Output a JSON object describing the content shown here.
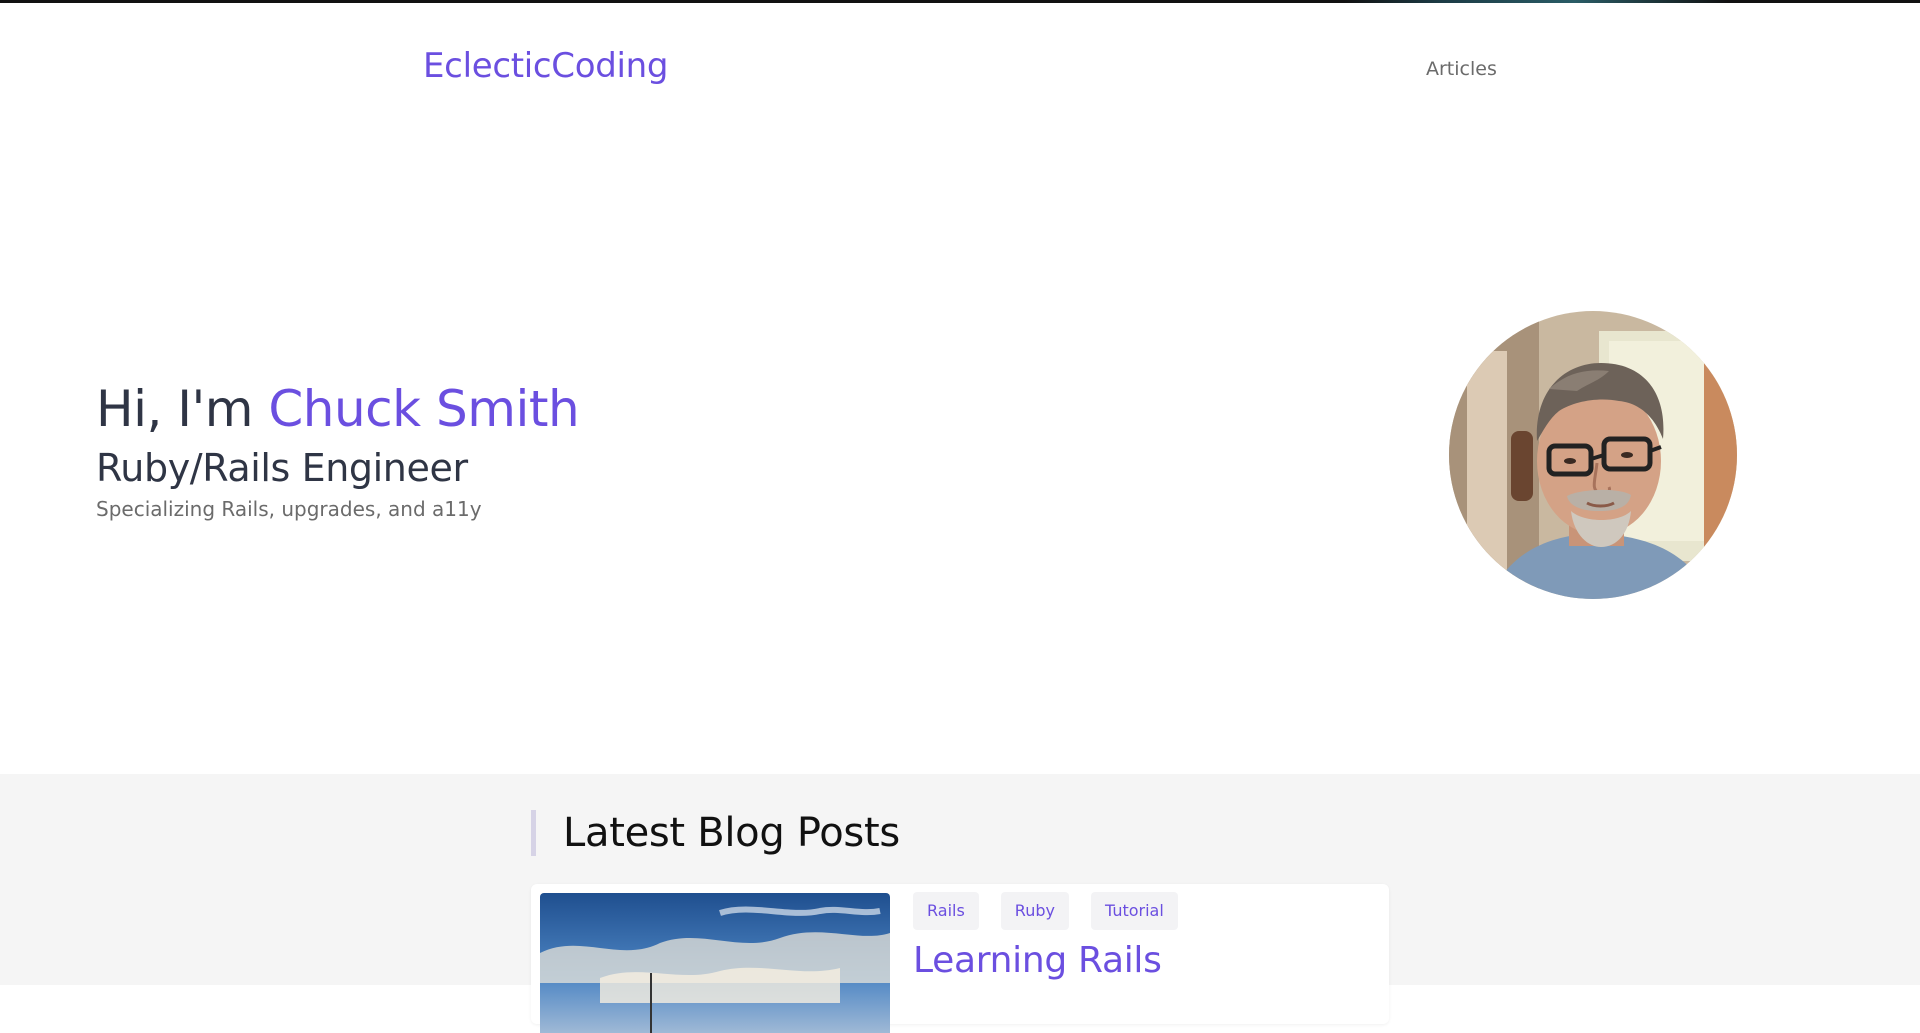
{
  "site": {
    "brand": "EclecticCoding",
    "nav": [
      {
        "label": "Articles"
      }
    ]
  },
  "hero": {
    "greeting": "Hi, I'm ",
    "name": "Chuck Smith",
    "role": "Ruby/Rails Engineer",
    "tagline": "Specializing Rails, upgrades, and a11y"
  },
  "blog": {
    "section_title": "Latest Blog Posts",
    "posts": [
      {
        "tags": [
          "Rails",
          "Ruby",
          "Tutorial"
        ],
        "title": "Learning Rails"
      }
    ]
  },
  "colors": {
    "accent": "#6b4fe0",
    "heading": "#2f3545",
    "muted": "#6b6b6b",
    "section_bg": "#f5f5f5"
  }
}
